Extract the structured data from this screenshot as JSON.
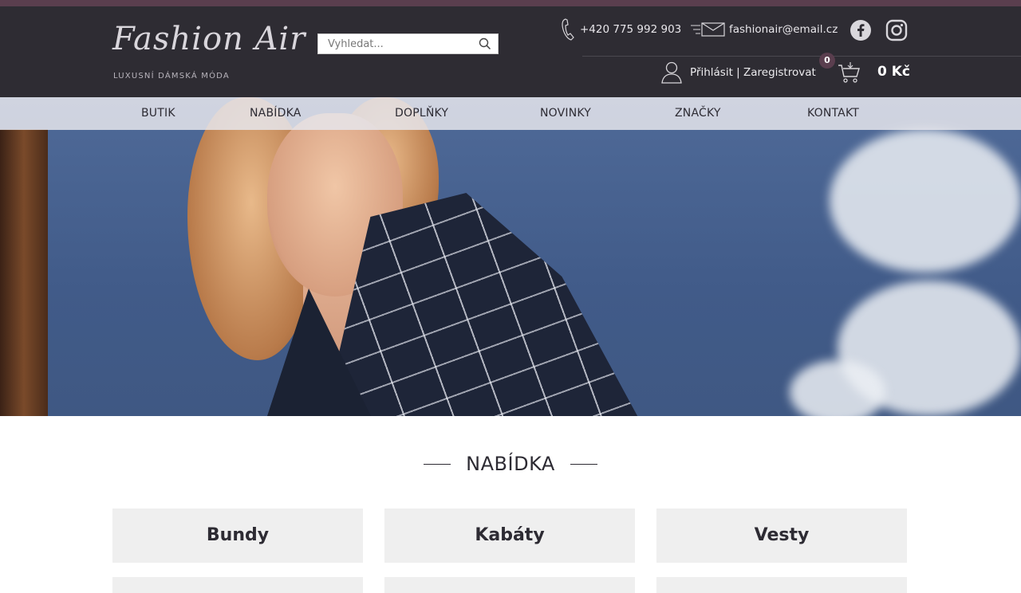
{
  "header": {
    "logo_text": "Fashion Air",
    "logo_tagline": "LUXUSNÍ DÁMSKÁ MÓDA",
    "search_placeholder": "Vyhledat...",
    "phone": "+420 775 992 903",
    "email": "fashionair@email.cz",
    "login_label": "Přihlásit | Zaregistrovat",
    "cart_count": "0",
    "cart_total": "0 Kč",
    "icons": [
      "search-icon",
      "phone-icon",
      "envelope-icon",
      "facebook-icon",
      "instagram-icon",
      "user-icon",
      "cart-icon"
    ]
  },
  "nav": {
    "items": [
      {
        "label": "BUTIK"
      },
      {
        "label": "NABÍDKA"
      },
      {
        "label": "DOPLŇKY"
      },
      {
        "label": "NOVINKY"
      },
      {
        "label": "ZNAČKY"
      },
      {
        "label": "KONTAKT"
      }
    ]
  },
  "section": {
    "title": "NABÍDKA"
  },
  "categories": [
    {
      "label": "Bundy"
    },
    {
      "label": "Kabáty"
    },
    {
      "label": "Vesty"
    }
  ],
  "colors": {
    "header_bg": "#2e2c33",
    "accent": "#5a3e4e",
    "tile_bg": "#efefef"
  }
}
